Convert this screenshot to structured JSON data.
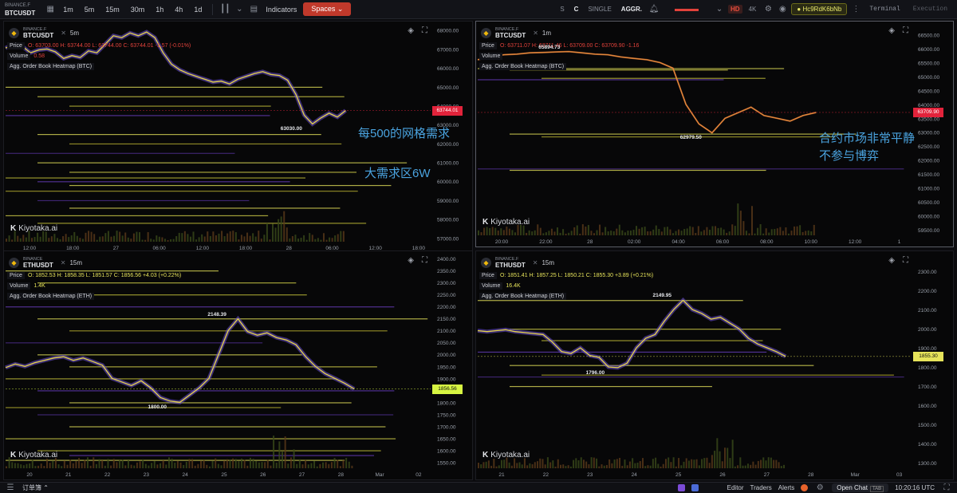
{
  "toolbar": {
    "exchange": "BINANCE.F",
    "symbol": "BTCUSDT",
    "timeframes": [
      "1m",
      "5m",
      "15m",
      "30m",
      "1h",
      "4h",
      "1d"
    ],
    "active_timeframe": "1m",
    "indicators_label": "Indicators",
    "spaces_label": "Spaces",
    "s_label": "S",
    "c_label": "C",
    "single_label": "SINGLE",
    "aggr_label": "AGGR.",
    "hd_label": "HD",
    "k4_label": "4K",
    "account_label": "Hc9RdK6bNb",
    "terminal_label": "Terminal",
    "execution_label": "Execution",
    "spaces_color": "#c0392b"
  },
  "panels": [
    {
      "exchange": "BINANCE.F",
      "symbol": "BTCUSDT",
      "timeframe": "5m",
      "legend_price": "Price",
      "legend_ohlc": "O: 63703.00 H: 63744.00 L: 63744.00 C: 63744.01 -1.57 (-0.01%)",
      "legend_volume_label": "Volume",
      "legend_volume": "0.58",
      "legend_heatmap": "Agg. Order Book Heatmap (BTC)",
      "last_price": "63744.01",
      "last_price_color": "#e2233b",
      "low_label": "63030.00",
      "watermark": "Kiyotaka.ai",
      "annotations": [
        "每500的网格需求",
        "大需求区6W"
      ]
    },
    {
      "exchange": "BINANCE.F",
      "symbol": "BTCUSDT",
      "timeframe": "1m",
      "legend_price": "Price",
      "legend_ohlc": "O: 63711.07 H: 63711.46 L: 63709.00 C: 63709.90 -1.16",
      "legend_volume_label": "Volume",
      "legend_volume": "",
      "legend_heatmap": "Agg. Order Book Heatmap (BTC)",
      "last_price": "63709.90",
      "last_price_color": "#e2233b",
      "high_label": "65894.73",
      "low_label": "62979.50",
      "watermark": "Kiyotaka.ai",
      "annotations": [
        "合约市场非常平静",
        "不参与博弈"
      ]
    },
    {
      "exchange": "BINANCE",
      "symbol": "ETHUSDT",
      "timeframe": "15m",
      "legend_price": "Price",
      "legend_ohlc": "O: 1852.53 H: 1858.35 L: 1851.57 C: 1856.56 +4.03 (+0.22%)",
      "legend_volume_label": "Volume",
      "legend_volume": "1.4K",
      "legend_heatmap": "Agg. Order Book Heatmap (ETH)",
      "last_price": "1856.56",
      "last_price_color": "#d7f542",
      "high_label": "2148.39",
      "low_label": "1800.00",
      "watermark": "Kiyotaka.ai"
    },
    {
      "exchange": "BINANCE.F",
      "symbol": "ETHUSDT",
      "timeframe": "15m",
      "legend_price": "Price",
      "legend_ohlc": "O: 1851.41 H: 1857.25 L: 1850.21 C: 1855.30 +3.89 (+0.21%)",
      "legend_volume_label": "Volume",
      "legend_volume": "16.4K",
      "legend_heatmap": "Agg. Order Book Heatmap (ETH)",
      "last_price": "1855.30",
      "last_price_color": "#e6e35a",
      "high_label": "2149.95",
      "low_label": "1796.00",
      "watermark": "Kiyotaka.ai"
    }
  ],
  "chart_data": [
    {
      "type": "line",
      "title": "BTCUSDT 5m",
      "x_ticks": [
        "12:00",
        "18:00",
        "27",
        "06:00",
        "12:00",
        "18:00",
        "28",
        "06:00",
        "12:00",
        "18:00"
      ],
      "y_ticks": [
        68000,
        67000,
        66000,
        65000,
        64000,
        63000,
        62000,
        61000,
        60000,
        59000,
        58000,
        57000
      ],
      "ylim": [
        56800,
        68200
      ],
      "series": [
        {
          "values": [
            67050,
            67250,
            67150,
            66800,
            66950,
            67000,
            66850,
            66500,
            66650,
            66550,
            66900,
            66800,
            67250,
            67700,
            67600,
            67850,
            67700,
            67900,
            67600,
            66800,
            66200,
            65900,
            65700,
            65550,
            65400,
            65250,
            65300,
            65150,
            65400,
            65550,
            65700,
            65800,
            65650,
            65600,
            65350,
            64600,
            63500,
            63030,
            63350,
            63600,
            63400,
            63744
          ]
        }
      ],
      "heatmap_levels": [
        65000,
        64500,
        64000,
        63500,
        62500,
        62000,
        61500,
        61000,
        60500,
        60200,
        60000,
        59800,
        59500,
        59000,
        58600,
        58200,
        57800
      ]
    },
    {
      "type": "line",
      "title": "BTCUSDT 1m",
      "x_ticks": [
        "20:00",
        "22:00",
        "28",
        "02:00",
        "04:00",
        "06:00",
        "08:00",
        "10:00",
        "12:00",
        "1"
      ],
      "y_ticks": [
        66500,
        66000,
        65500,
        65000,
        64500,
        64000,
        63500,
        63000,
        62500,
        62000,
        61500,
        61000,
        60500,
        60000,
        59500
      ],
      "ylim": [
        59300,
        66800
      ],
      "series": [
        {
          "values": [
            65600,
            65700,
            65780,
            65800,
            65850,
            65860,
            65880,
            65894,
            65850,
            65800,
            65780,
            65700,
            65650,
            65600,
            65500,
            65300,
            64000,
            63300,
            62979,
            63500,
            63700,
            63900,
            63600,
            63500,
            63400,
            63600,
            63709
          ]
        }
      ],
      "heatmap_levels": [
        65300,
        65250,
        64950,
        64900,
        62950,
        62850,
        61700,
        61650
      ]
    },
    {
      "type": "line",
      "title": "ETHUSDT 15m",
      "x_ticks": [
        "20",
        "21",
        "22",
        "23",
        "24",
        "25",
        "26",
        "27",
        "28",
        "Mar",
        "02"
      ],
      "y_ticks": [
        2400,
        2350,
        2300,
        2250,
        2200,
        2150,
        2100,
        2050,
        2000,
        1950,
        1900,
        1850,
        1800,
        1750,
        1700,
        1650,
        1600,
        1550
      ],
      "ylim": [
        1525,
        2410
      ],
      "series": [
        {
          "values": [
            1945,
            1960,
            1950,
            1965,
            1975,
            1985,
            1990,
            1975,
            1985,
            1970,
            1955,
            1900,
            1885,
            1870,
            1890,
            1860,
            1820,
            1805,
            1800,
            1830,
            1860,
            1900,
            2000,
            2100,
            2148,
            2095,
            2080,
            2090,
            2070,
            2060,
            2040,
            1990,
            1950,
            1920,
            1900,
            1880,
            1856
          ]
        }
      ],
      "heatmap_levels": [
        2350,
        2300,
        2250,
        2200,
        2150,
        2100,
        2050,
        2000,
        1950,
        1900,
        1850,
        1800,
        1780,
        1750,
        1700,
        1650,
        1600,
        1580,
        1560
      ]
    },
    {
      "type": "line",
      "title": "ETHUSDT 15m",
      "x_ticks": [
        "21",
        "22",
        "23",
        "24",
        "25",
        "26",
        "27",
        "28",
        "Mar",
        "03"
      ],
      "y_ticks": [
        2300,
        2200,
        2100,
        2000,
        1900,
        1800,
        1700,
        1600,
        1500,
        1400,
        1300
      ],
      "ylim": [
        1270,
        2380
      ],
      "series": [
        {
          "values": [
            1990,
            1985,
            1990,
            1995,
            1985,
            1980,
            1975,
            1970,
            1930,
            1880,
            1870,
            1900,
            1860,
            1850,
            1800,
            1796,
            1820,
            1900,
            1950,
            1970,
            2040,
            2100,
            2149,
            2100,
            2080,
            2050,
            2060,
            2030,
            2000,
            1950,
            1920,
            1900,
            1880,
            1855
          ]
        }
      ],
      "heatmap_levels": [
        2150,
        2000,
        1940,
        1880,
        1810,
        1760,
        1750,
        1700
      ]
    }
  ]
}
